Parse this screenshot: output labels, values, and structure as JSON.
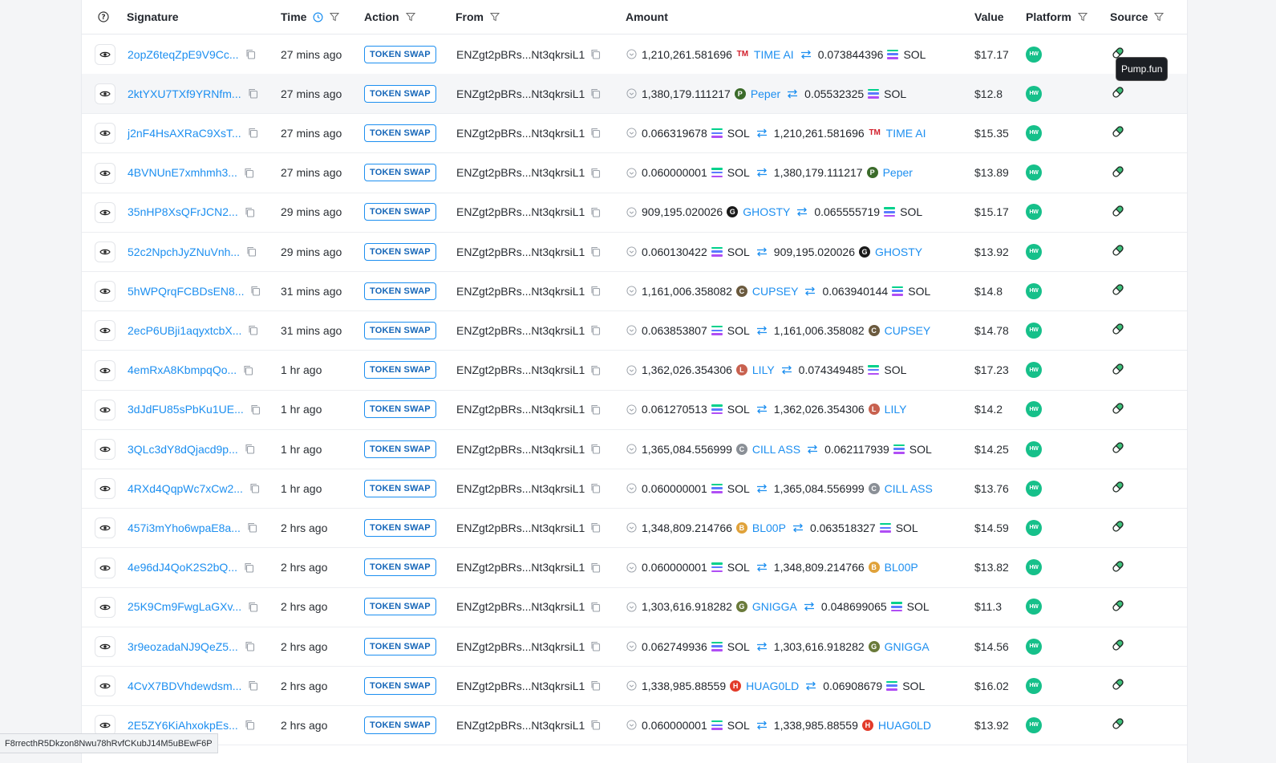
{
  "columns": {
    "signature": "Signature",
    "time": "Time",
    "action": "Action",
    "from": "From",
    "amount": "Amount",
    "value": "Value",
    "platform": "Platform",
    "source": "Source"
  },
  "tooltip": "Pump.fun",
  "status_url": "F8rrecthR5Dkzon8Nwu78hRvfCKubJ14M5uBEwF6P",
  "colors": {
    "link": "#1d8ff0",
    "platform": "#16c08a",
    "badge": "#1566b8"
  },
  "platform_badge": "HW",
  "rows": [
    {
      "sig": "2opZ6teqZpE9V9Cc...",
      "time": "27 mins ago",
      "action": "TOKEN SWAP",
      "from": "ENZgt2pBRs...Nt3qkrsiL1",
      "a1": "1,210,261.581696",
      "t1": "TIME AI",
      "a2": "0.073844396",
      "t2": "SOL",
      "value": "$17.17"
    },
    {
      "sig": "2ktYXU7TXf9YRNfm...",
      "time": "27 mins ago",
      "action": "TOKEN SWAP",
      "from": "ENZgt2pBRs...Nt3qkrsiL1",
      "a1": "1,380,179.111217",
      "t1": "Peper",
      "a2": "0.05532325",
      "t2": "SOL",
      "value": "$12.8"
    },
    {
      "sig": "j2nF4HsAXRaC9XsT...",
      "time": "27 mins ago",
      "action": "TOKEN SWAP",
      "from": "ENZgt2pBRs...Nt3qkrsiL1",
      "a1": "0.066319678",
      "t1": "SOL",
      "a2": "1,210,261.581696",
      "t2": "TIME AI",
      "value": "$15.35"
    },
    {
      "sig": "4BVNUnE7xmhmh3...",
      "time": "27 mins ago",
      "action": "TOKEN SWAP",
      "from": "ENZgt2pBRs...Nt3qkrsiL1",
      "a1": "0.060000001",
      "t1": "SOL",
      "a2": "1,380,179.111217",
      "t2": "Peper",
      "value": "$13.89"
    },
    {
      "sig": "35nHP8XsQFrJCN2...",
      "time": "29 mins ago",
      "action": "TOKEN SWAP",
      "from": "ENZgt2pBRs...Nt3qkrsiL1",
      "a1": "909,195.020026",
      "t1": "GHOSTY",
      "a2": "0.065555719",
      "t2": "SOL",
      "value": "$15.17"
    },
    {
      "sig": "52c2NpchJyZNuVnh...",
      "time": "29 mins ago",
      "action": "TOKEN SWAP",
      "from": "ENZgt2pBRs...Nt3qkrsiL1",
      "a1": "0.060130422",
      "t1": "SOL",
      "a2": "909,195.020026",
      "t2": "GHOSTY",
      "value": "$13.92"
    },
    {
      "sig": "5hWPQrqFCBDsEN8...",
      "time": "31 mins ago",
      "action": "TOKEN SWAP",
      "from": "ENZgt2pBRs...Nt3qkrsiL1",
      "a1": "1,161,006.358082",
      "t1": "CUPSEY",
      "a2": "0.063940144",
      "t2": "SOL",
      "value": "$14.8"
    },
    {
      "sig": "2ecP6UBji1aqyxtcbX...",
      "time": "31 mins ago",
      "action": "TOKEN SWAP",
      "from": "ENZgt2pBRs...Nt3qkrsiL1",
      "a1": "0.063853807",
      "t1": "SOL",
      "a2": "1,161,006.358082",
      "t2": "CUPSEY",
      "value": "$14.78"
    },
    {
      "sig": "4emRxA8KbmpqQo...",
      "time": "1 hr ago",
      "action": "TOKEN SWAP",
      "from": "ENZgt2pBRs...Nt3qkrsiL1",
      "a1": "1,362,026.354306",
      "t1": "LILY",
      "a2": "0.074349485",
      "t2": "SOL",
      "value": "$17.23"
    },
    {
      "sig": "3dJdFU85sPbKu1UE...",
      "time": "1 hr ago",
      "action": "TOKEN SWAP",
      "from": "ENZgt2pBRs...Nt3qkrsiL1",
      "a1": "0.061270513",
      "t1": "SOL",
      "a2": "1,362,026.354306",
      "t2": "LILY",
      "value": "$14.2"
    },
    {
      "sig": "3QLc3dY8dQjacd9p...",
      "time": "1 hr ago",
      "action": "TOKEN SWAP",
      "from": "ENZgt2pBRs...Nt3qkrsiL1",
      "a1": "1,365,084.556999",
      "t1": "CILL ASS",
      "a2": "0.062117939",
      "t2": "SOL",
      "value": "$14.25"
    },
    {
      "sig": "4RXd4QqpWc7xCw2...",
      "time": "1 hr ago",
      "action": "TOKEN SWAP",
      "from": "ENZgt2pBRs...Nt3qkrsiL1",
      "a1": "0.060000001",
      "t1": "SOL",
      "a2": "1,365,084.556999",
      "t2": "CILL ASS",
      "value": "$13.76"
    },
    {
      "sig": "457i3mYho6wpaE8a...",
      "time": "2 hrs ago",
      "action": "TOKEN SWAP",
      "from": "ENZgt2pBRs...Nt3qkrsiL1",
      "a1": "1,348,809.214766",
      "t1": "BL00P",
      "a2": "0.063518327",
      "t2": "SOL",
      "value": "$14.59"
    },
    {
      "sig": "4e96dJ4QoK2S2bQ...",
      "time": "2 hrs ago",
      "action": "TOKEN SWAP",
      "from": "ENZgt2pBRs...Nt3qkrsiL1",
      "a1": "0.060000001",
      "t1": "SOL",
      "a2": "1,348,809.214766",
      "t2": "BL00P",
      "value": "$13.82"
    },
    {
      "sig": "25K9Cm9FwgLaGXv...",
      "time": "2 hrs ago",
      "action": "TOKEN SWAP",
      "from": "ENZgt2pBRs...Nt3qkrsiL1",
      "a1": "1,303,616.918282",
      "t1": "GNIGGA",
      "a2": "0.048699065",
      "t2": "SOL",
      "value": "$11.3"
    },
    {
      "sig": "3r9eozadaNJ9QeZ5...",
      "time": "2 hrs ago",
      "action": "TOKEN SWAP",
      "from": "ENZgt2pBRs...Nt3qkrsiL1",
      "a1": "0.062749936",
      "t1": "SOL",
      "a2": "1,303,616.918282",
      "t2": "GNIGGA",
      "value": "$14.56"
    },
    {
      "sig": "4CvX7BDVhdewdsm...",
      "time": "2 hrs ago",
      "action": "TOKEN SWAP",
      "from": "ENZgt2pBRs...Nt3qkrsiL1",
      "a1": "1,338,985.88559",
      "t1": "HUAG0LD",
      "a2": "0.06908679",
      "t2": "SOL",
      "value": "$16.02"
    },
    {
      "sig": "2E5ZY6KiAhxokpEs...",
      "time": "2 hrs ago",
      "action": "TOKEN SWAP",
      "from": "ENZgt2pBRs...Nt3qkrsiL1",
      "a1": "0.060000001",
      "t1": "SOL",
      "a2": "1,338,985.88559",
      "t2": "HUAG0LD",
      "value": "$13.92"
    }
  ]
}
